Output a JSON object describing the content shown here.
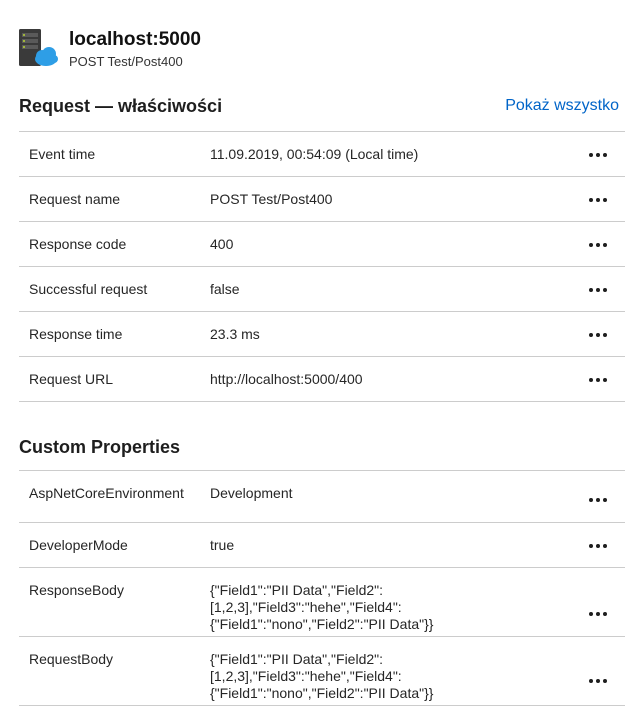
{
  "header": {
    "title": "localhost:5000",
    "subtitle": "POST Test/Post400",
    "icon": "server-cloud-icon"
  },
  "request_section": {
    "title": "Request — właściwości",
    "show_all_label": "Pokaż wszystko",
    "rows": [
      {
        "key": "Event time",
        "value": "11.09.2019, 00:54:09 (Local time)"
      },
      {
        "key": "Request name",
        "value": "POST Test/Post400"
      },
      {
        "key": "Response code",
        "value": "400"
      },
      {
        "key": "Successful request",
        "value": "false"
      },
      {
        "key": "Response time",
        "value": "23.3 ms"
      },
      {
        "key": "Request URL",
        "value": "http://localhost:5000/400"
      }
    ]
  },
  "custom_section": {
    "title": "Custom Properties",
    "rows": [
      {
        "key": "AspNetCoreEnvironment",
        "value": "Development"
      },
      {
        "key": "DeveloperMode",
        "value": "true"
      },
      {
        "key": "ResponseBody",
        "value": "{\"Field1\":\"PII Data\",\"Field2\": [1,2,3],\"Field3\":\"hehe\",\"Field4\": {\"Field1\":\"nono\",\"Field2\":\"PII Data\"}}"
      },
      {
        "key": "RequestBody",
        "value": "{\"Field1\":\"PII Data\",\"Field2\": [1,2,3],\"Field3\":\"hehe\",\"Field4\": {\"Field1\":\"nono\",\"Field2\":\"PII Data\"}}"
      }
    ]
  },
  "colors": {
    "link": "#0064c8",
    "divider": "#cccccc",
    "icon_cloud": "#2e9ee6",
    "icon_server": "#3a3a3a"
  }
}
